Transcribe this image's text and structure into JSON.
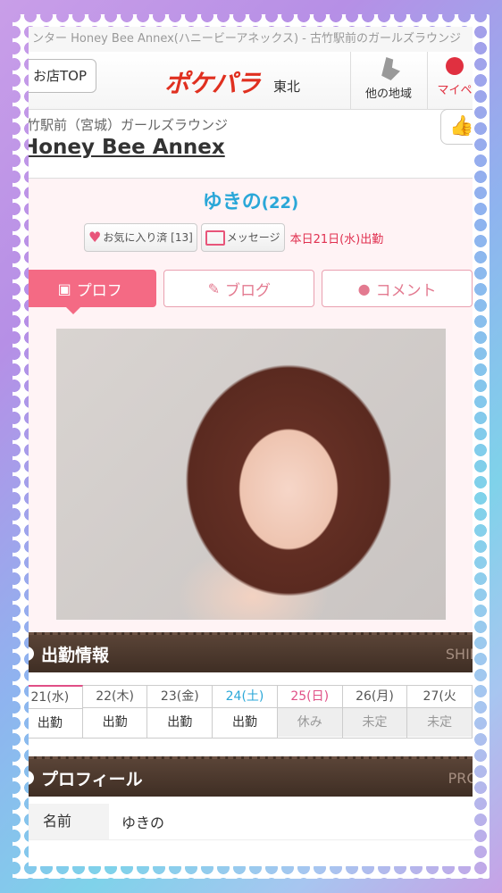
{
  "url_bar": "ンター Honey Bee Annex(ハニービーアネックス) - 古竹駅前のガールズラウンジ",
  "header": {
    "shop_top": "お店TOP",
    "logo": "ポケパラ",
    "logo_region": "東北",
    "other_area": "他の地域",
    "mypage": "マイペ"
  },
  "shop": {
    "area": "竹駅前（宮城）ガールズラウンジ",
    "name": "Honey Bee Annex"
  },
  "girl": {
    "name": "ゆきの",
    "age": "(22)",
    "favorite": "お気に入り済 [13]",
    "message": "メッセージ",
    "today": "本日21日(水)出勤"
  },
  "tabs": [
    {
      "label": "プロフ"
    },
    {
      "label": "ブログ"
    },
    {
      "label": "コメント"
    }
  ],
  "schedule": {
    "title": "出勤情報",
    "en": "SHIF",
    "days": [
      {
        "date": "21(水)",
        "status": "出勤"
      },
      {
        "date": "22(木)",
        "status": "出勤"
      },
      {
        "date": "23(金)",
        "status": "出勤"
      },
      {
        "date": "24(土)",
        "status": "出勤"
      },
      {
        "date": "25(日)",
        "status": "休み"
      },
      {
        "date": "26(月)",
        "status": "未定"
      },
      {
        "date": "27(火",
        "status": "未定"
      }
    ]
  },
  "profile": {
    "title": "プロフィール",
    "en": "PRO",
    "rows": [
      {
        "key": "名前",
        "value": "ゆきの"
      }
    ]
  },
  "colors": {
    "accent_pink": "#f46a84",
    "name_blue": "#2aa7d8",
    "bar_brown": "#4a372c"
  }
}
